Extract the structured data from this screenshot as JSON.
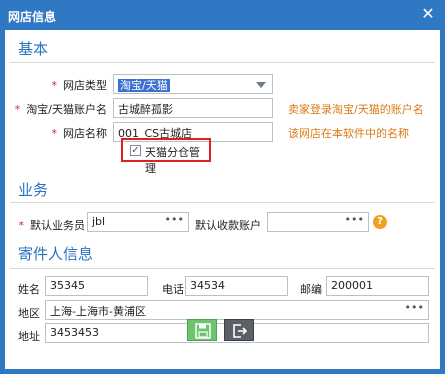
{
  "window": {
    "title": "网店信息",
    "close_label": "✕"
  },
  "sections": {
    "basic": "基本",
    "business": "业务",
    "sender": "寄件人信息"
  },
  "basic": {
    "store_type_label": "网店类型",
    "store_type_value": "淘宝/天猫",
    "account_label": "淘宝/天猫账户名",
    "account_value": "古城醉孤影",
    "account_hint": "卖家登录淘宝/天猫的账户名",
    "store_name_label": "网店名称",
    "store_name_value": "001_CS古城店",
    "store_name_hint": "该网店在本软件中的名称",
    "tmall_checkbox_label": "天猫分仓管理",
    "tmall_checkbox_checked": true
  },
  "business": {
    "salesperson_label": "默认业务员",
    "salesperson_value": "jbl",
    "account_label": "默认收款账户",
    "account_value": "",
    "dots": "•••",
    "help": "?"
  },
  "sender": {
    "name_label": "姓名",
    "name_value": "35345",
    "phone_label": "电话",
    "phone_value": "34534",
    "zip_label": "邮编",
    "zip_value": "200001",
    "region_label": "地区",
    "region_value": "上海-上海市-黄浦区",
    "address_label": "地址",
    "address_value": "3453453"
  }
}
